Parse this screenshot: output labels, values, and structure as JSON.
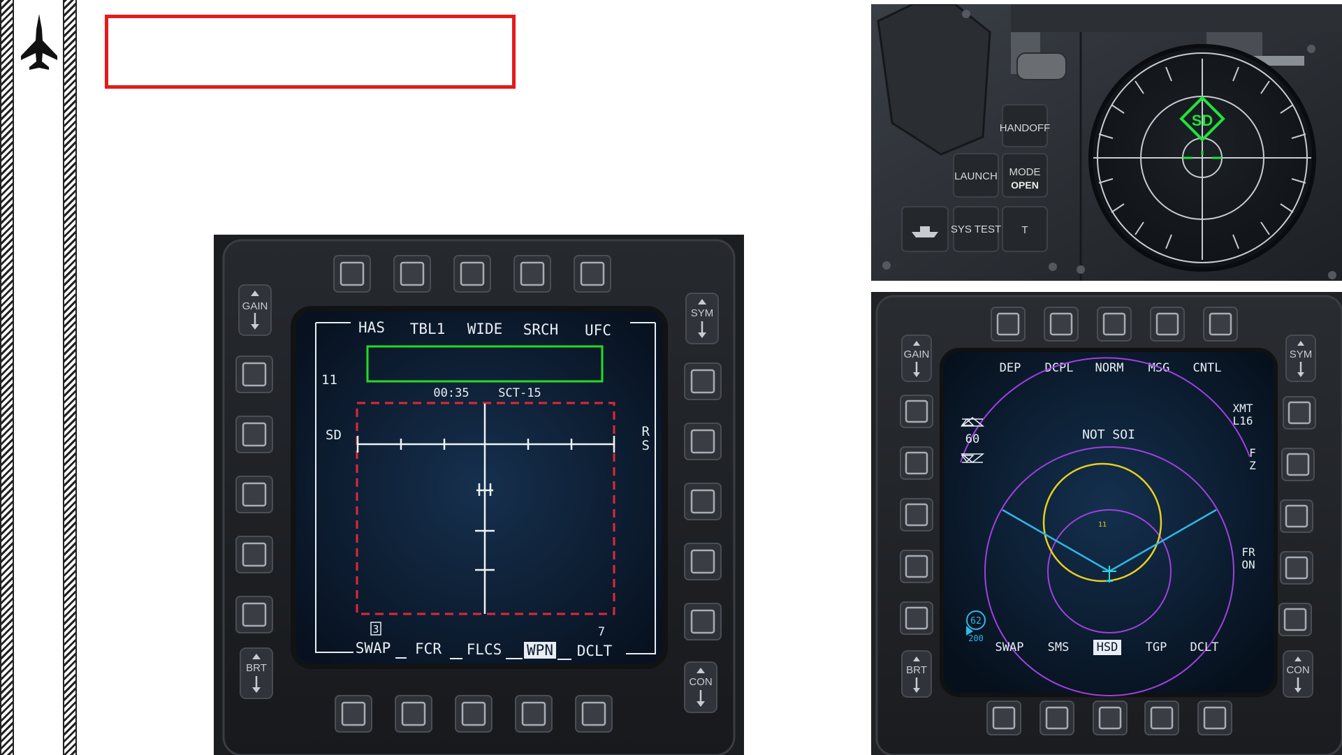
{
  "sidebar": {
    "icon": "fighter-jet-icon"
  },
  "fcr_mfd": {
    "rocker_labels": {
      "gain": "GAIN",
      "sym": "SYM",
      "brt": "BRT",
      "con": "CON"
    },
    "top_labels": [
      "HAS",
      "TBL1",
      "WIDE",
      "SRCH",
      "UFC"
    ],
    "bottom_labels": [
      "SWAP",
      "FCR",
      "FLCS",
      "WPN",
      "DCLT"
    ],
    "selected_bottom": "WPN",
    "left_label": "SD",
    "right_label": "RS",
    "count_label": "11",
    "time": "00:35",
    "sector": "SCT-15",
    "corner_left": "3",
    "corner_right": "7",
    "colors": {
      "highlight": "#22dd22",
      "scan_box": "#e0283a",
      "screen": "#0c1a2e"
    }
  },
  "harm_panel": {
    "buttons": {
      "handoff": "HANDOFF",
      "launch": "LAUNCH",
      "mode": "MODE",
      "mode_status": "OPEN",
      "sys_test": "SYS TEST",
      "t": "T"
    },
    "scope_symbol": "SD",
    "colors": {
      "symbol": "#1fe53a"
    }
  },
  "hsd_mfd": {
    "rocker_labels": {
      "gain": "GAIN",
      "sym": "SYM",
      "brt": "BRT",
      "con": "CON"
    },
    "top_labels": [
      "DEP",
      "DCPL",
      "NORM",
      "MSG",
      "CNTL"
    ],
    "bottom_labels": [
      "SWAP",
      "SMS",
      "HSD",
      "TGP",
      "DCLT"
    ],
    "selected_bottom": "HSD",
    "range": "60",
    "xmt": "XMT",
    "xmt_value": "L16",
    "fz_top": "F",
    "fz_bottom": "Z",
    "fr": "FR",
    "on": "ON",
    "status": "NOT SOI",
    "ring_label": "11",
    "bullseye_top": "62",
    "bullseye_bottom": "200",
    "colors": {
      "ring": "#a040e0",
      "yellow": "#e8d020",
      "cyan": "#30b8e8"
    }
  }
}
